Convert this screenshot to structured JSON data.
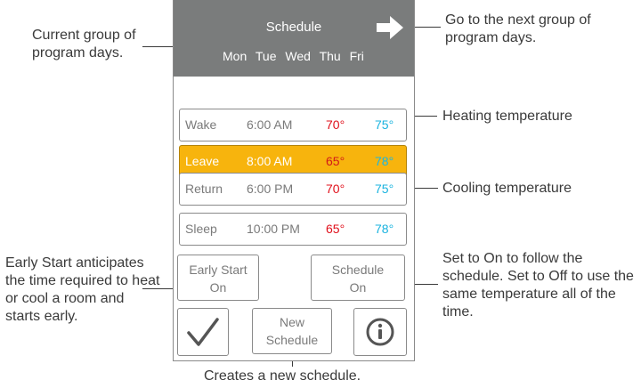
{
  "header": {
    "title": "Schedule",
    "days": [
      "Mon",
      "Tue",
      "Wed",
      "Thu",
      "Fri"
    ]
  },
  "schedule_rows": [
    {
      "name": "Wake",
      "time": "6:00 AM",
      "heat": "70°",
      "cool": "75°",
      "selected": false
    },
    {
      "name": "Leave",
      "time": "8:00 AM",
      "heat": "65°",
      "cool": "78°",
      "selected": true
    },
    {
      "name": "Return",
      "time": "6:00 PM",
      "heat": "70°",
      "cool": "75°",
      "selected": false
    },
    {
      "name": "Sleep",
      "time": "10:00 PM",
      "heat": "65°",
      "cool": "78°",
      "selected": false
    }
  ],
  "buttons": {
    "early_start": {
      "label": "Early Start",
      "value": "On"
    },
    "schedule": {
      "label": "Schedule",
      "value": "On"
    },
    "new_schedule": {
      "line1": "New",
      "line2": "Schedule"
    }
  },
  "icons": {
    "next": "arrow-right-icon",
    "confirm": "checkmark-icon",
    "info": "info-icon"
  },
  "colors": {
    "header_bg": "#7a7c7c",
    "selected_row": "#f7b40d",
    "heat": "#e0101b",
    "cool": "#1ab3df"
  },
  "annotations": {
    "current_group": "Current group of program days.",
    "next_group": "Go to the next group of program days.",
    "heating": "Heating temperature",
    "cooling": "Cooling temperature",
    "early_start": "Early Start anticipates the time required to heat or cool a room and starts early.",
    "schedule_toggle": "Set to On to follow the schedule. Set to Off to use the same temperature all of the time.",
    "new_schedule": "Creates a new schedule."
  }
}
